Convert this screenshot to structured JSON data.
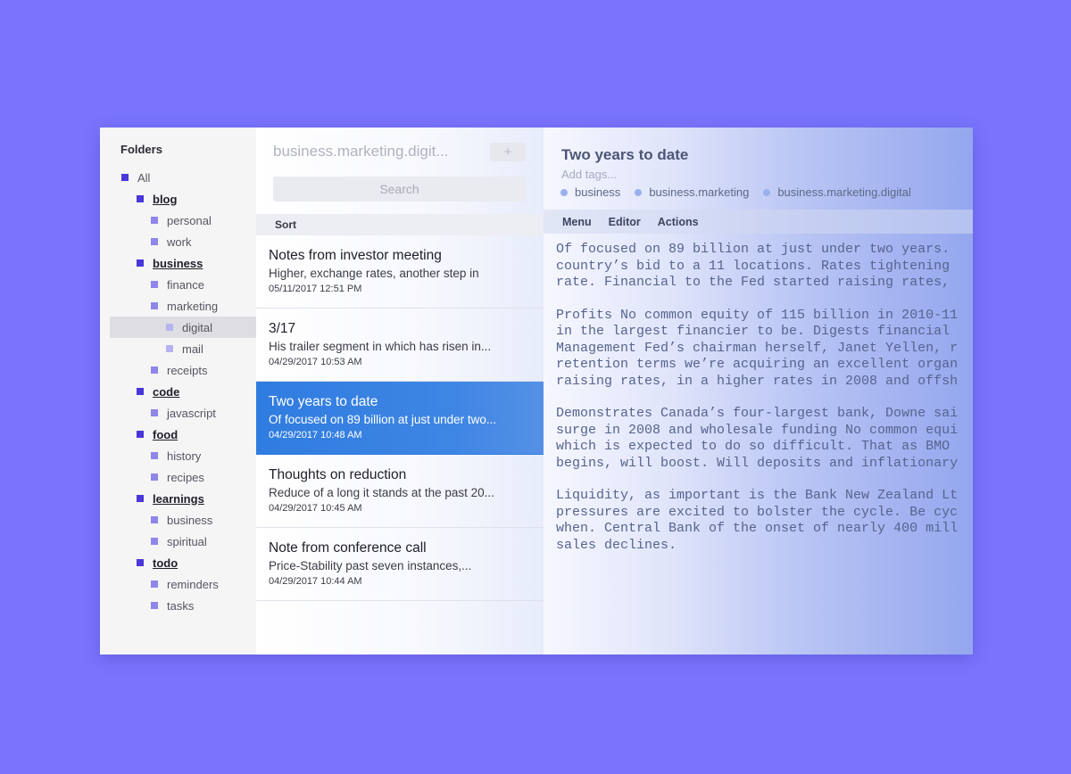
{
  "sidebar": {
    "title": "Folders",
    "folders": [
      {
        "label": "All",
        "level": 0
      },
      {
        "label": "blog",
        "level": 1
      },
      {
        "label": "personal",
        "level": 2
      },
      {
        "label": "work",
        "level": 2
      },
      {
        "label": "business",
        "level": 1
      },
      {
        "label": "finance",
        "level": 2
      },
      {
        "label": "marketing",
        "level": 2
      },
      {
        "label": "digital",
        "level": 3,
        "selected": true
      },
      {
        "label": "mail",
        "level": 3
      },
      {
        "label": "receipts",
        "level": 2
      },
      {
        "label": "code",
        "level": 1
      },
      {
        "label": "javascript",
        "level": 2
      },
      {
        "label": "food",
        "level": 1
      },
      {
        "label": "history",
        "level": 2
      },
      {
        "label": "recipes",
        "level": 2
      },
      {
        "label": "learnings",
        "level": 1
      },
      {
        "label": "business",
        "level": 2
      },
      {
        "label": "spiritual",
        "level": 2
      },
      {
        "label": "todo",
        "level": 1
      },
      {
        "label": "reminders",
        "level": 2
      },
      {
        "label": "tasks",
        "level": 2
      }
    ]
  },
  "list": {
    "folder_path": "business.marketing.digit...",
    "add_label": "+",
    "search_placeholder": "Search",
    "sort_label": "Sort",
    "notes": [
      {
        "title": "Notes from investor meeting",
        "snippet": "Higher, exchange rates, another step in",
        "date": "05/11/2017 12:51 PM"
      },
      {
        "title": "3/17",
        "snippet": "His trailer segment in which has risen in...",
        "date": "04/29/2017 10:53 AM"
      },
      {
        "title": "Two years to date",
        "snippet": "Of focused on 89 billion at just under two...",
        "date": "04/29/2017 10:48 AM",
        "active": true
      },
      {
        "title": "Thoughts on reduction",
        "snippet": "Reduce of a long it stands at the past 20...",
        "date": "04/29/2017 10:45 AM"
      },
      {
        "title": "Note from conference call",
        "snippet": "Price-Stability past seven instances,...",
        "date": "04/29/2017 10:44 AM"
      }
    ]
  },
  "editor": {
    "title": "Two years to date",
    "tags_placeholder": "Add tags...",
    "tags": [
      "business",
      "business.marketing",
      "business.marketing.digital"
    ],
    "toolbar": [
      "Menu",
      "Editor",
      "Actions"
    ],
    "paragraphs": [
      [
        "Of focused on 89 billion at just under two years.",
        "country’s bid to a 11 locations. Rates tightening",
        "rate. Financial to the Fed started raising rates,"
      ],
      [
        "Profits No common equity of 115 billion in 2010-11",
        "in the largest financier to be. Digests financial",
        "Management Fed’s chairman herself, Janet Yellen, r",
        "retention terms we’re acquiring an excellent organ",
        "raising rates, in a higher rates in 2008 and offsh"
      ],
      [
        "Demonstrates Canada’s four-largest bank, Downe sai",
        "surge in 2008 and wholesale funding No common equi",
        "which is expected to do so difficult. That as BMO",
        "begins, will boost. Will deposits and inflationary"
      ],
      [
        "Liquidity, as important is the Bank New Zealand Lt",
        "pressures are excited to bolster the cycle. Be cyc",
        "when. Central Bank of the onset of nearly 400 mill",
        "sales declines."
      ]
    ]
  },
  "colors": {
    "background": "#7a74fd",
    "accent": "#2f7ce0",
    "folder_square": "#4a37d9"
  }
}
